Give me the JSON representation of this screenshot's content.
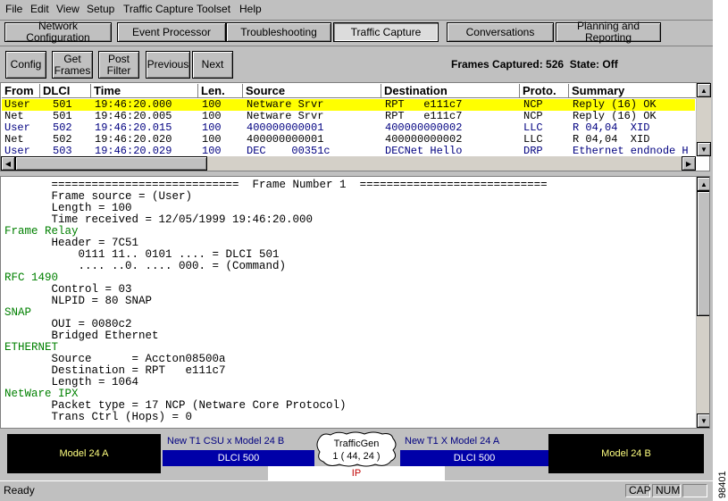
{
  "menu": [
    "File",
    "Edit",
    "View",
    "Setup",
    "Traffic Capture",
    "Toolset",
    "Help"
  ],
  "tabs": [
    "Network Configuration",
    "Event Processor",
    "Troubleshooting",
    "Traffic Capture",
    "Conversations",
    "Planning and Reporting"
  ],
  "active_tab": "Traffic Capture",
  "toolbar": {
    "config": "Config",
    "get_frames_1": "Get",
    "get_frames_2": "Frames",
    "post_filter_1": "Post",
    "post_filter_2": "Filter",
    "previous": "Previous",
    "next": "Next",
    "status": "Frames Captured: 526  State: Off"
  },
  "list": {
    "columns": [
      "From",
      "DLCI",
      "Time",
      "Len.",
      "Source",
      "Destination",
      "Proto.",
      "Summary"
    ],
    "rows": [
      {
        "from": "User",
        "dlci": "501",
        "time": "19:46:20.000",
        "len": "100",
        "source": "Netware Srvr",
        "dest": "RPT   e111c7",
        "proto": "NCP",
        "summary": "Reply (16) OK",
        "highlight": true,
        "color": "#000000"
      },
      {
        "from": "Net",
        "dlci": "501",
        "time": "19:46:20.005",
        "len": "100",
        "source": "Netware Srvr",
        "dest": "RPT   e111c7",
        "proto": "NCP",
        "summary": "Reply (16) OK",
        "highlight": false,
        "color": "#000000"
      },
      {
        "from": "User",
        "dlci": "502",
        "time": "19:46:20.015",
        "len": "100",
        "source": "400000000001",
        "dest": "400000000002",
        "proto": "LLC",
        "summary": "R 04,04  XID",
        "highlight": false,
        "color": "#000080"
      },
      {
        "from": "Net",
        "dlci": "502",
        "time": "19:46:20.020",
        "len": "100",
        "source": "400000000001",
        "dest": "400000000002",
        "proto": "LLC",
        "summary": "R 04,04  XID",
        "highlight": false,
        "color": "#000000"
      },
      {
        "from": "User",
        "dlci": "503",
        "time": "19:46:20.029",
        "len": "100",
        "source": "DEC    00351c",
        "dest": "DECNet Hello",
        "proto": "DRP",
        "summary": "Ethernet endnode H",
        "highlight": false,
        "color": "#000080"
      }
    ]
  },
  "detail": [
    {
      "text": "       ============================  Frame Number 1  ============================",
      "green": false
    },
    {
      "text": "       Frame source = (User)",
      "green": false
    },
    {
      "text": "       Length = 100",
      "green": false
    },
    {
      "text": "       Time received = 12/05/1999 19:46:20.000",
      "green": false
    },
    {
      "text": "Frame Relay",
      "green": true
    },
    {
      "text": "       Header = 7C51",
      "green": false
    },
    {
      "text": "           0111 11.. 0101 .... = DLCI 501",
      "green": false
    },
    {
      "text": "           .... ..0. .... 000. = (Command)",
      "green": false
    },
    {
      "text": "RFC 1490",
      "green": true
    },
    {
      "text": "       Control = 03",
      "green": false
    },
    {
      "text": "       NLPID = 80 SNAP",
      "green": false
    },
    {
      "text": "SNAP",
      "green": true
    },
    {
      "text": "       OUI = 0080c2",
      "green": false
    },
    {
      "text": "       Bridged Ethernet",
      "green": false
    },
    {
      "text": "ETHERNET",
      "green": true
    },
    {
      "text": "       Source      = Accton08500a",
      "green": false
    },
    {
      "text": "       Destination = RPT   e111c7",
      "green": false
    },
    {
      "text": "       Length = 1064",
      "green": false
    },
    {
      "text": "NetWare IPX",
      "green": true
    },
    {
      "text": "       Packet type = 17 NCP (Netware Core Protocol)",
      "green": false
    },
    {
      "text": "       Trans Ctrl (Hops) = 0",
      "green": false
    }
  ],
  "topology": {
    "left_device": "Model 24 A",
    "left_link_title": "New T1 CSU x Model 24 B",
    "left_link_dlci": "DLCI 500",
    "center_title": "TrafficGen",
    "center_value": "1 ( 44, 24 )",
    "center_proto": "IP",
    "right_link_title": "New T1 X Model 24 A",
    "right_link_dlci": "DLCI 500",
    "right_device": "Model 24 B"
  },
  "status": {
    "text": "Ready",
    "cap": "CAP",
    "num": "NUM"
  },
  "side_label": "98401"
}
